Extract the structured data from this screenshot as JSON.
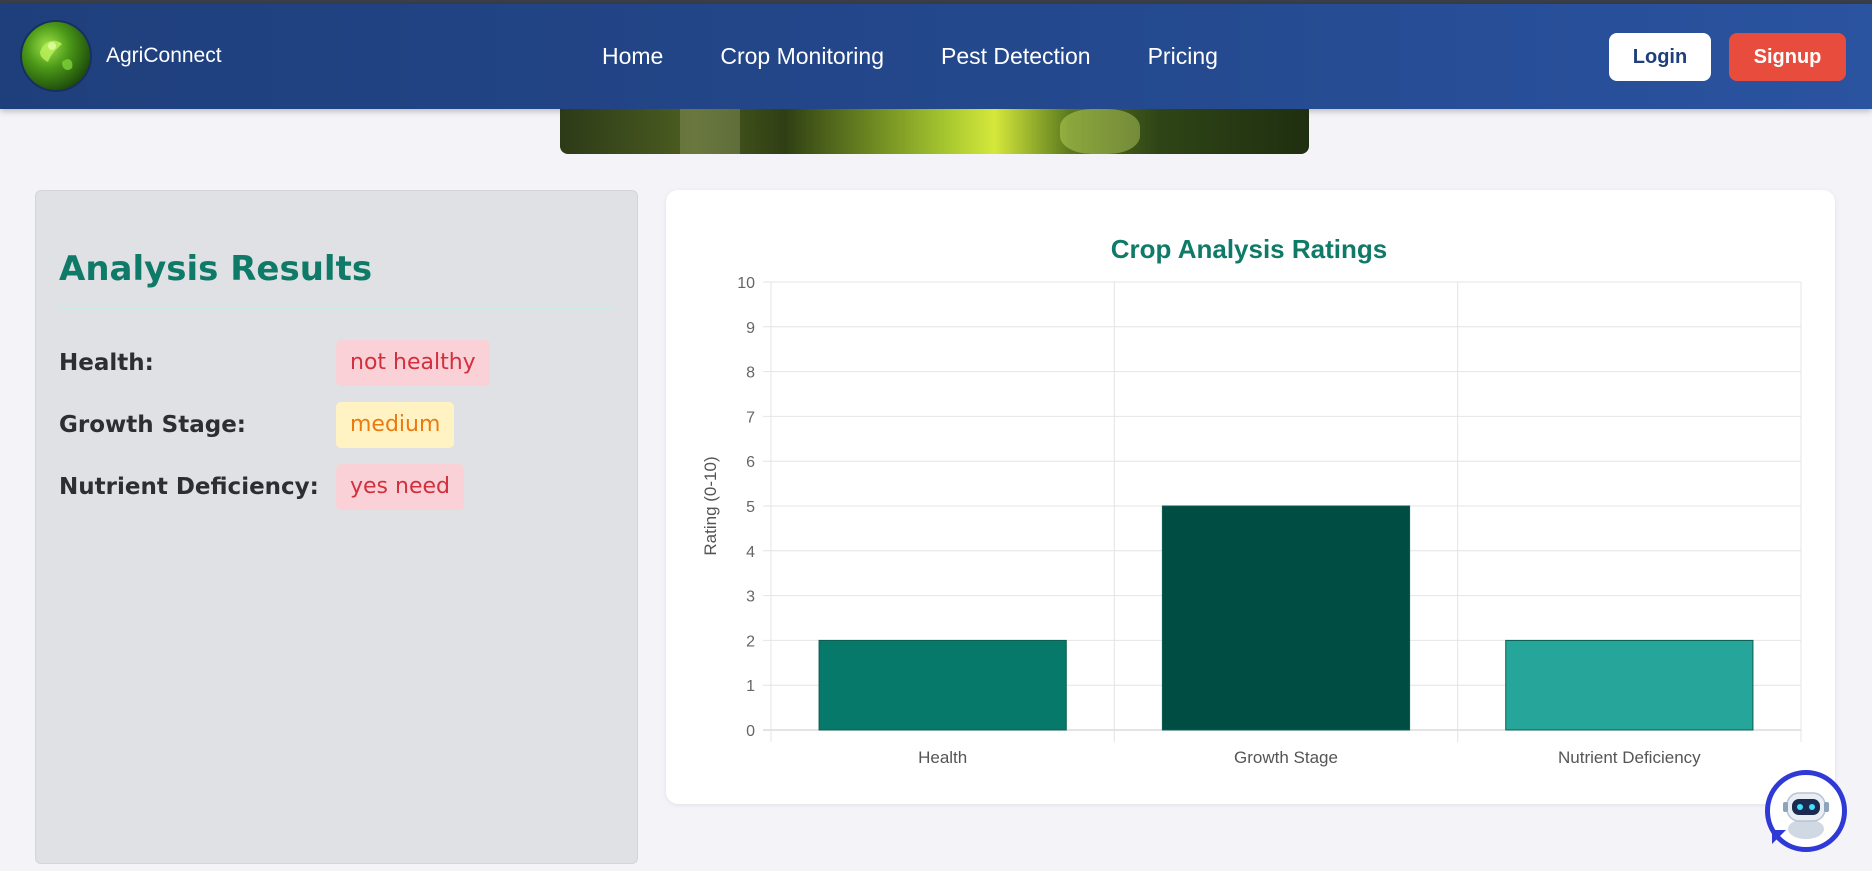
{
  "app": {
    "brand_name": "AgriConnect",
    "logo_icon": "green-globe-logo"
  },
  "nav": {
    "links": [
      "Home",
      "Crop Monitoring",
      "Pest Detection",
      "Pricing"
    ],
    "login_label": "Login",
    "signup_label": "Signup"
  },
  "results": {
    "title": "Analysis Results",
    "rows": [
      {
        "label": "Health:",
        "value": "not healthy",
        "tone": "red"
      },
      {
        "label": "Growth Stage:",
        "value": "medium",
        "tone": "yellow"
      },
      {
        "label": "Nutrient Deficiency:",
        "value": "yes need",
        "tone": "red"
      }
    ]
  },
  "colors": {
    "navbar": "#24498e",
    "signup": "#e84c3d",
    "accent_teal": "#0f7a67",
    "badge_red_bg": "#f9d1d6",
    "badge_yellow_bg": "#fff3c4"
  },
  "chart_data": {
    "type": "bar",
    "title": "Crop Analysis Ratings",
    "xlabel": "",
    "ylabel": "Rating (0-10)",
    "categories": [
      "Health",
      "Growth Stage",
      "Nutrient Deficiency"
    ],
    "values": [
      2,
      5,
      2
    ],
    "colors": [
      "#06796b",
      "#004e43",
      "#26a69a"
    ],
    "ylim": [
      0,
      10
    ],
    "yticks": [
      0,
      1,
      2,
      3,
      4,
      5,
      6,
      7,
      8,
      9,
      10
    ],
    "grid": true,
    "legend": "none"
  },
  "chatbot": {
    "icon": "robot-chat-icon"
  }
}
